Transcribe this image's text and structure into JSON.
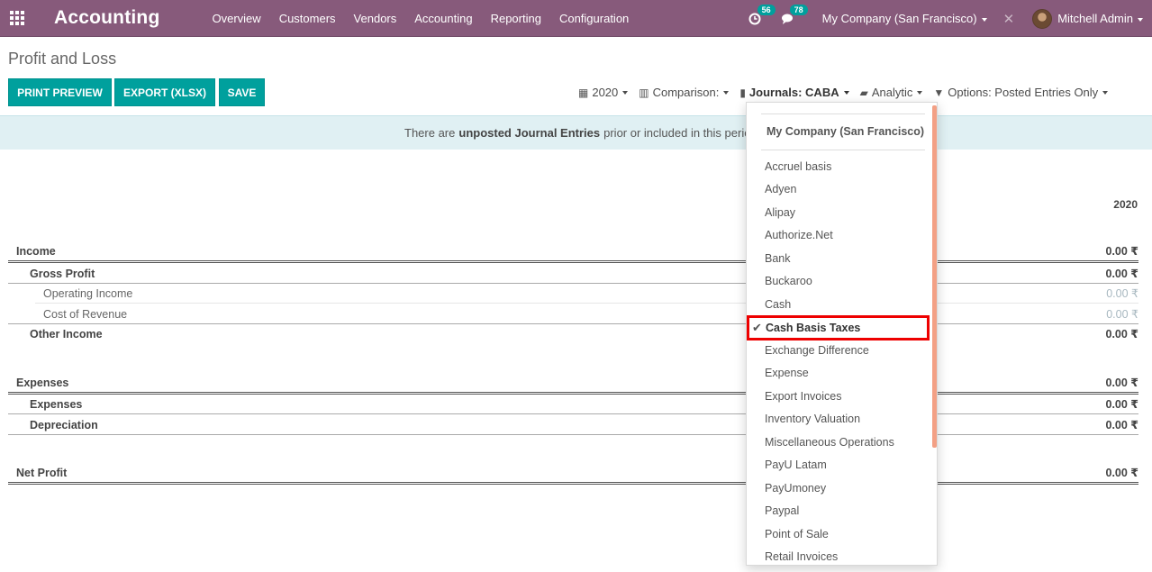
{
  "navbar": {
    "brand": "Accounting",
    "menu": [
      "Overview",
      "Customers",
      "Vendors",
      "Accounting",
      "Reporting",
      "Configuration"
    ],
    "activity_count": "56",
    "messages_count": "78",
    "company": "My Company (San Francisco)",
    "user": "Mitchell Admin"
  },
  "control": {
    "breadcrumb": "Profit and Loss",
    "buttons": {
      "print": "PRINT PREVIEW",
      "export": "EXPORT (XLSX)",
      "save": "SAVE"
    },
    "filters": {
      "date": "2020",
      "comparison": "Comparison:",
      "journals": "Journals: CABA",
      "analytic": "Analytic",
      "options": "Options: Posted Entries Only"
    }
  },
  "alert": {
    "prefix": "There are",
    "bold": "unposted Journal Entries",
    "suffix": "prior or included in this period"
  },
  "report": {
    "column": "2020",
    "rows": [
      {
        "label": "Income",
        "amount": "0.00 ₹"
      },
      {
        "label": "Gross Profit",
        "amount": "0.00 ₹"
      },
      {
        "label": "Operating Income",
        "amount": "0.00 ₹"
      },
      {
        "label": "Cost of Revenue",
        "amount": "0.00 ₹"
      },
      {
        "label": "Other Income",
        "amount": "0.00 ₹"
      },
      {
        "label": "Expenses",
        "amount": "0.00 ₹"
      },
      {
        "label": "Expenses",
        "amount": "0.00 ₹"
      },
      {
        "label": "Depreciation",
        "amount": "0.00 ₹"
      },
      {
        "label": "Net Profit",
        "amount": "0.00 ₹"
      }
    ]
  },
  "journals_dropdown": {
    "header": "My Company (San Francisco)",
    "items": [
      "Accruel basis",
      "Adyen",
      "Alipay",
      "Authorize.Net",
      "Bank",
      "Buckaroo",
      "Cash",
      "Cash Basis Taxes",
      "Exchange Difference",
      "Expense",
      "Export Invoices",
      "Inventory Valuation",
      "Miscellaneous Operations",
      "PayU Latam",
      "PayUmoney",
      "Paypal",
      "Point of Sale",
      "Retail Invoices"
    ],
    "selected": "Cash Basis Taxes"
  },
  "colors": {
    "navbar": "#875a7b",
    "button": "#00a09d",
    "highlight": "#e00000"
  }
}
